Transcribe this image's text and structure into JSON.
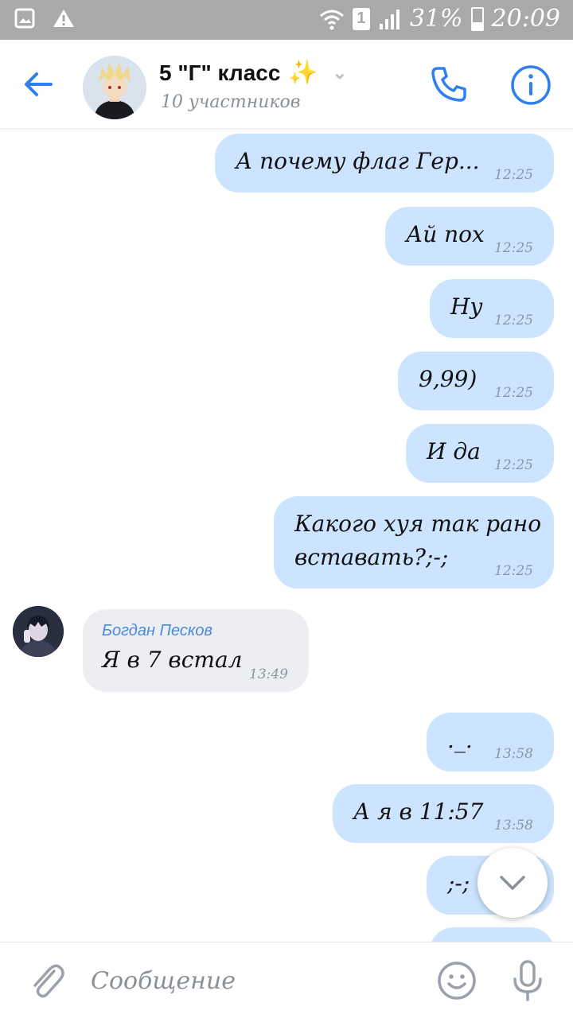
{
  "status_bar": {
    "battery": "31%",
    "time": "20:09",
    "sim": "1",
    "icons": [
      "image-icon",
      "warning-icon",
      "wifi-icon",
      "sim-icon",
      "signal-icon",
      "battery-charging-icon"
    ]
  },
  "header": {
    "title": "5 \"Г\" класс",
    "title_emoji": "✨",
    "subtitle": "10 участников"
  },
  "messages": [
    {
      "direction": "out",
      "text": "А почему флаг Гер...",
      "time": "12:25"
    },
    {
      "direction": "out",
      "text": "Ай пох",
      "time": "12:25"
    },
    {
      "direction": "out",
      "text": "Ну",
      "time": "12:25"
    },
    {
      "direction": "out",
      "text": "9,99)",
      "time": "12:25"
    },
    {
      "direction": "out",
      "text": "И да",
      "time": "12:25"
    },
    {
      "direction": "out",
      "text": "Какого хуя так рано",
      "text2": "вставать?;-;",
      "time": "12:25"
    },
    {
      "direction": "in",
      "sender": "Богдан Песков",
      "text": "Я в 7 встал",
      "time": "13:49"
    },
    {
      "direction": "out",
      "text": "._.",
      "time": "13:58"
    },
    {
      "direction": "out",
      "text": "А я в 11:57",
      "time": "13:58"
    },
    {
      "direction": "out",
      "text": ";-;",
      "time": ""
    }
  ],
  "composer": {
    "placeholder": "Сообщение"
  },
  "colors": {
    "accent": "#2f80ed",
    "bubble_out": "#cce4ff",
    "bubble_in": "#eceef1",
    "status_bar": "#a9a9a9"
  }
}
